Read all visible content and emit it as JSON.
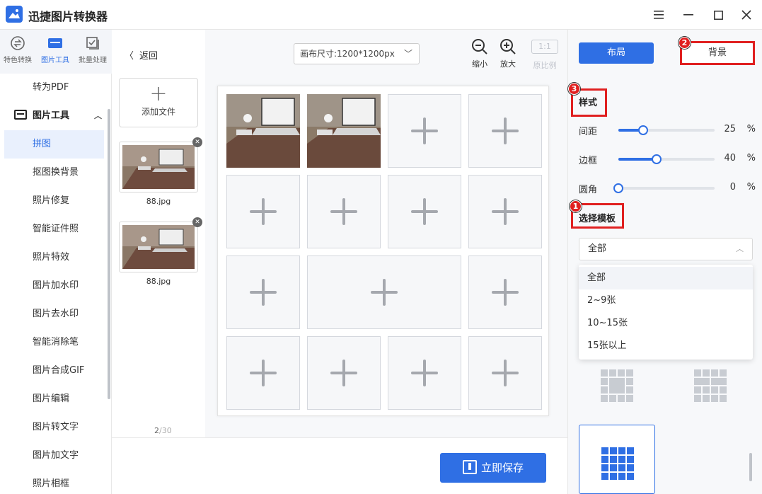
{
  "app": {
    "title": "迅捷图片转换器"
  },
  "window": {
    "menu_icon": "menu-icon",
    "minimize_icon": "minimize-icon",
    "maximize_icon": "maximize-icon",
    "close_icon": "close-icon"
  },
  "topnav": [
    {
      "label": "特色转换",
      "icon": "convert-icon"
    },
    {
      "label": "图片工具",
      "icon": "image-tools-icon"
    },
    {
      "label": "批量处理",
      "icon": "batch-icon"
    }
  ],
  "sidebar": {
    "items_before": [
      "转为PDF"
    ],
    "group": {
      "label": "图片工具",
      "icon": "image-tools-icon"
    },
    "items": [
      "拼图",
      "抠图换背景",
      "照片修复",
      "智能证件照",
      "照片特效",
      "图片加水印",
      "图片去水印",
      "智能消除笔",
      "图片合成GIF",
      "图片编辑",
      "图片转文字",
      "图片加文字",
      "照片相框"
    ],
    "active_item": "拼图"
  },
  "files": {
    "back_label": "返回",
    "add_label": "添加文件",
    "list": [
      {
        "name": "88.jpg"
      },
      {
        "name": "88.jpg"
      }
    ],
    "count_current": "2",
    "count_total": "/30"
  },
  "canvas": {
    "size_label": "画布尺寸:1200*1200px",
    "zoom_out_label": "缩小",
    "zoom_in_label": "放大",
    "ratio_box": "1:1",
    "ratio_label": "原比例"
  },
  "save": {
    "label": "立即保存"
  },
  "panel": {
    "tab_layout": "布局",
    "tab_background": "背景",
    "style_title": "样式",
    "sliders": [
      {
        "label": "间距",
        "value": 25,
        "unit": "%"
      },
      {
        "label": "边框",
        "value": 40,
        "unit": "%"
      },
      {
        "label": "圆角",
        "value": 0,
        "unit": "%"
      }
    ],
    "template_title": "选择模板",
    "template_selected": "全部",
    "template_options": [
      "全部",
      "2~9张",
      "10~15张",
      "15张以上"
    ],
    "badges": [
      "1",
      "2",
      "3"
    ]
  },
  "colors": {
    "accent": "#2f6fe4",
    "highlight": "#e02020"
  }
}
